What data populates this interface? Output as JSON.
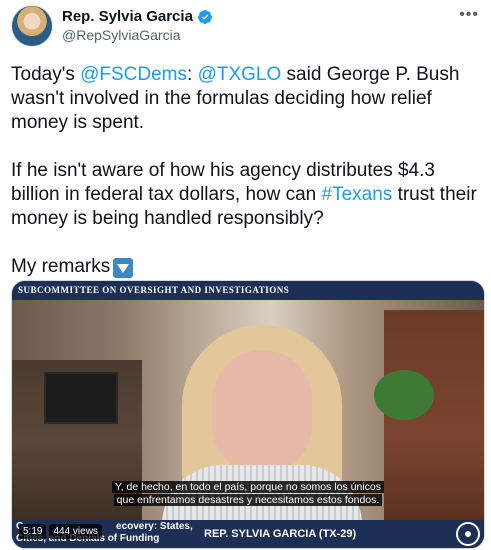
{
  "tweet": {
    "author_name": "Rep. Sylvia Garcia",
    "author_handle": "@RepSylviaGarcia",
    "paragraph1": {
      "prefix": "Today's ",
      "mention1": "@FSCDems",
      "sep": ": ",
      "mention2": "@TXGLO",
      "rest": " said George P. Bush wasn't involved in the formulas deciding how relief money is spent."
    },
    "paragraph2": {
      "prefix": "If he isn't aware of how his agency distributes $4.3 billion in federal tax dollars, how can ",
      "hashtag": "#Texans",
      "rest": " trust their money is being handled responsibly?"
    },
    "paragraph3": "My remarks"
  },
  "video": {
    "header": "Subcommittee on Oversight and Investigations",
    "subtitle_line1": "Y, de hecho, en todo el país, porque no somos los únicos",
    "subtitle_line2": "que enfrentamos desastres y necesitamos estos fondos.",
    "lower_third_left_line1": "C",
    "lower_third_left_line2_visible": "ecovery: States,",
    "lower_third_left_line3": "Cities, and Denials of Funding",
    "lower_third_right": "REP. SYLVIA GARCIA (TX-29)",
    "timestamp": "5:19",
    "views": "444 views"
  },
  "colors": {
    "link": "#1d9bf0",
    "verified": "#1d9bf0",
    "banner": "#1d2f55"
  }
}
